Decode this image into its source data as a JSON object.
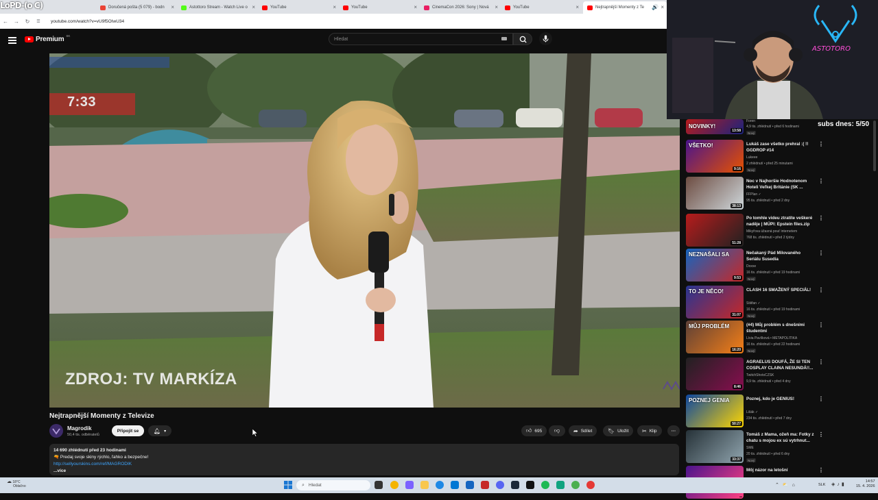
{
  "browser": {
    "stream_logo": "LoPD-(o C)",
    "tabs": [
      {
        "label": "Doručená pošta (5 079) - bodn",
        "color": "#ea4335"
      },
      {
        "label": "Astottoro Stream - Watch Live o",
        "color": "#53fc18"
      },
      {
        "label": "YouTube",
        "color": "#ff0000"
      },
      {
        "label": "YouTube",
        "color": "#ff0000"
      },
      {
        "label": "CinemaCon 2026: Sony | Nová",
        "color": "#e91e63"
      },
      {
        "label": "YouTube",
        "color": "#ff0000"
      },
      {
        "label": "Nejtrapnější Momenty z Te",
        "color": "#ff0000"
      }
    ],
    "url": "youtube.com/watch?v=vU9f5OIwU34"
  },
  "header": {
    "logo_text": "Premium",
    "country_code": "SK",
    "search_placeholder": "Hledat"
  },
  "video": {
    "overlay_time": "7:33",
    "overlay_source": "ZDROJ: TV MARKÍZA",
    "title": "Nejtrapnější Momenty z Televize",
    "channel": "Magrodik",
    "subscribers": "50,4 tis. odběratelů",
    "join_label": "Připojit se",
    "likes": "695",
    "share_label": "Sdílet",
    "save_label": "Uložit",
    "clip_label": "Klip",
    "description": {
      "stats": "14 690 zhlédnutí  před 23 hodinami",
      "line1": "🔫 Predaj svoje skiny rýchlo, ľahko a bezpečne!",
      "link": "http://sellyourskins.com/ref/MAGRODIK",
      "more": "...více"
    }
  },
  "stream": {
    "subs_today": "subs dnes: 5/50"
  },
  "recommendations": [
    {
      "title": "NOVINKY!",
      "channel": "Foren",
      "meta": "4,9 tis. zhlédnutí • před 6 hodinami",
      "badge": "Nový",
      "duration": "13:58",
      "color1": "#b71c1c",
      "color2": "#1a237e",
      "thumb_text": "NOVINKY!"
    },
    {
      "title": "Lukáš zase všetko prehral :( !! GGDROP #14",
      "channel": "Lukeee",
      "meta": "2 zhlédnutí • před 25 minutami",
      "badge": "Nový",
      "duration": "9:16",
      "color1": "#4a148c",
      "color2": "#e65100",
      "thumb_text": "VŠETKO!"
    },
    {
      "title": "Noc v Najhoršie Hodnotenom Hoteli Veľkej Británie (SK ...",
      "channel": "FFPlan ✓",
      "meta": "95 tis. zhlédnutí • před 2 dny",
      "badge": "",
      "duration": "38:13",
      "color1": "#6d4c41",
      "color2": "#cfd8dc",
      "thumb_text": ""
    },
    {
      "title": "Po tomhle videu ztratíte veškeré naděje | MÚPI: Epstein files.zip",
      "channel": "Mikyřova úžasná pouť internetem",
      "meta": "768 tis. zhlédnutí • před 2 týdny",
      "badge": "",
      "duration": "51:28",
      "color1": "#b71c1c",
      "color2": "#212121",
      "thumb_text": ""
    },
    {
      "title": "Nečakaný Pád Milovaného Seriálu Susedia",
      "channel": "Doxxe",
      "meta": "16 tis. zhlédnutí • před 19 hodinami",
      "badge": "Nový",
      "duration": "9:53",
      "color1": "#1565c0",
      "color2": "#c62828",
      "thumb_text": "NEZNAŠALI SA"
    },
    {
      "title": "CLASH 16 SMAŽENÝ SPECIÁL!",
      "channel": "Stiiifan ✓",
      "meta": "16 tis. zhlédnutí • před 19 hodinami",
      "badge": "Nový",
      "duration": "31:07",
      "color1": "#283593",
      "color2": "#c62828",
      "thumb_text": "TO JE NĚCO!"
    },
    {
      "title": "(#4) Můj problém s dnešními študentmi",
      "channel": "Lívia Pavlíková • METAPOLITIKA",
      "meta": "16 tis. zhlédnutí • před 22 hodinami",
      "badge": "Nový",
      "duration": "16:20",
      "color1": "#5d4037",
      "color2": "#f57f17",
      "thumb_text": "MŮJ PROBLÉM"
    },
    {
      "title": "AGRAELUS DOUFÁ, ŽE SI TEN COSPLAY CLAINA NESUNDÁ!!...",
      "channel": "TwitchShotsCZSK",
      "meta": "9,9 tis. zhlédnutí • před 4 dny",
      "badge": "",
      "duration": "8:46",
      "color1": "#212121",
      "color2": "#880e4f",
      "thumb_text": ""
    },
    {
      "title": "Poznej, kdo je GENIUS!",
      "channel": "Lišák ✓",
      "meta": "234 tis. zhlédnutí • před 7 dny",
      "badge": "",
      "duration": "50:27",
      "color1": "#0d47a1",
      "color2": "#ffd600",
      "thumb_text": "POZNEJ GENIA"
    },
    {
      "title": "Tomáš z Mama, ožeň ma: Fotky z chatu s mojou ex sú vytrhnut...",
      "channel": "SME",
      "meta": "20 tis. zhlédnutí • před 6 dny",
      "badge": "Nový",
      "duration": "33:37",
      "color1": "#263238",
      "color2": "#90a4ae",
      "thumb_text": ""
    },
    {
      "title": "Môj názor na letošní",
      "channel": "",
      "meta": "",
      "badge": "",
      "duration": "",
      "color1": "#4a148c",
      "color2": "#ff4081",
      "thumb_text": ""
    }
  ],
  "taskbar": {
    "weather_temp": "18°C",
    "weather_desc": "Oblačno",
    "search_label": "Hledat",
    "lang": "SLK",
    "time": "14:57",
    "date": "15. 4. 2026"
  }
}
